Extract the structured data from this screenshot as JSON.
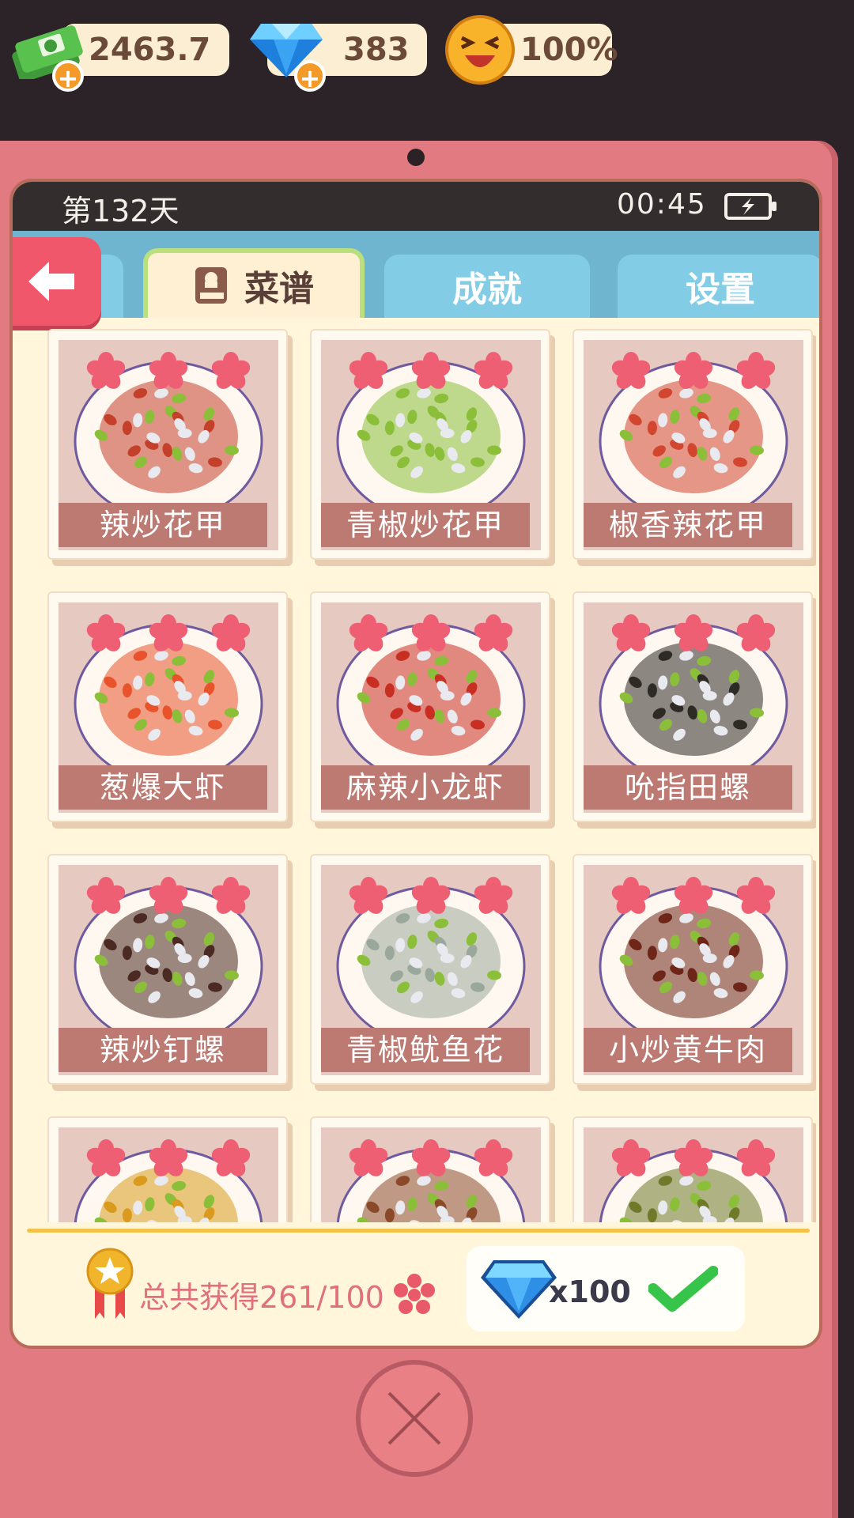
{
  "resources": {
    "cash": {
      "value": "2463.7",
      "icon": "cash-stack-icon"
    },
    "gems": {
      "value": "383",
      "icon": "diamond-icon"
    },
    "mood": {
      "value": "100%",
      "icon": "laughing-face-icon"
    }
  },
  "status": {
    "day": "第132天",
    "time": "00:45",
    "battery_icon": "battery-charging-icon"
  },
  "tabs": {
    "recipe": "菜谱",
    "achievements": "成就",
    "settings": "设置"
  },
  "recipes": [
    {
      "name": "辣炒花甲",
      "dish": "clams",
      "tint": "#c4402b"
    },
    {
      "name": "青椒炒花甲",
      "dish": "clams",
      "tint": "#8bbf3a"
    },
    {
      "name": "椒香辣花甲",
      "dish": "clams",
      "tint": "#d2452f"
    },
    {
      "name": "葱爆大虾",
      "dish": "shrimp",
      "tint": "#e8532c"
    },
    {
      "name": "麻辣小龙虾",
      "dish": "crayfish",
      "tint": "#c92e22"
    },
    {
      "name": "吮指田螺",
      "dish": "snails",
      "tint": "#2e2a26"
    },
    {
      "name": "辣炒钉螺",
      "dish": "whelks",
      "tint": "#4a2a22"
    },
    {
      "name": "青椒鱿鱼花",
      "dish": "squid",
      "tint": "#9aa79b"
    },
    {
      "name": "小炒黄牛肉",
      "dish": "beef",
      "tint": "#6e2618"
    },
    {
      "name": "",
      "dish": "stew",
      "tint": "#d99a1e"
    },
    {
      "name": "",
      "dish": "stew",
      "tint": "#8a4a2a"
    },
    {
      "name": "",
      "dish": "stew",
      "tint": "#6e7a2a"
    }
  ],
  "reward": {
    "total_text": "总共获得261/100",
    "gem_count": "x100",
    "claimed": true
  },
  "colors": {
    "accent": "#e27b81",
    "tab_blue": "#82cce5",
    "tab_active_border": "#b9e07c",
    "back_red": "#f0576a"
  }
}
